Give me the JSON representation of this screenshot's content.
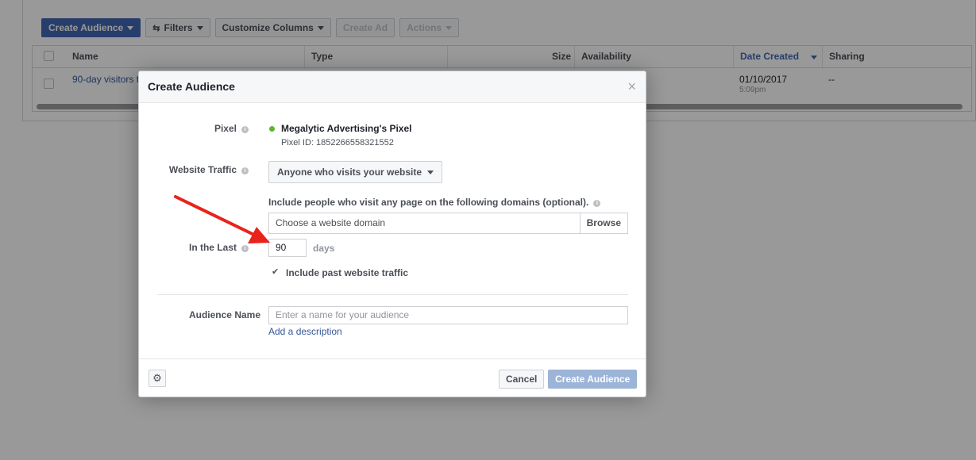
{
  "toolbar": {
    "create_audience": "Create Audience",
    "filters": "Filters",
    "customize_columns": "Customize Columns",
    "create_ad": "Create Ad",
    "actions": "Actions"
  },
  "table": {
    "columns": [
      "Name",
      "Type",
      "Size",
      "Availability",
      "Date Created",
      "Sharing"
    ],
    "rows": [
      {
        "name": "90-day visitors t",
        "date": "01/10/2017",
        "time": "5:09pm",
        "sharing": "--"
      }
    ]
  },
  "dialog": {
    "title": "Create Audience",
    "close_glyph": "×",
    "pixel": {
      "label": "Pixel",
      "name": "Megalytic Advertising's Pixel",
      "id_text": "Pixel ID: 1852266558321552",
      "status_color": "#5fb530"
    },
    "website_traffic": {
      "label": "Website Traffic",
      "selected": "Anyone who visits your website"
    },
    "domains": {
      "note": "Include people who visit any page on the following domains (optional).",
      "placeholder": "Choose a website domain",
      "browse": "Browse"
    },
    "in_the_last": {
      "label": "In the Last",
      "value": "90",
      "unit": "days"
    },
    "include_past": {
      "label": "Include past website traffic",
      "checked": true
    },
    "audience_name": {
      "label": "Audience Name",
      "placeholder": "Enter a name for your audience",
      "add_description": "Add a description"
    },
    "footer": {
      "cancel": "Cancel",
      "create": "Create Audience"
    }
  },
  "colors": {
    "primary": "#4267b2",
    "link": "#365899",
    "disabled_primary": "#9cb4d8",
    "annotation_arrow": "#e8231c"
  }
}
